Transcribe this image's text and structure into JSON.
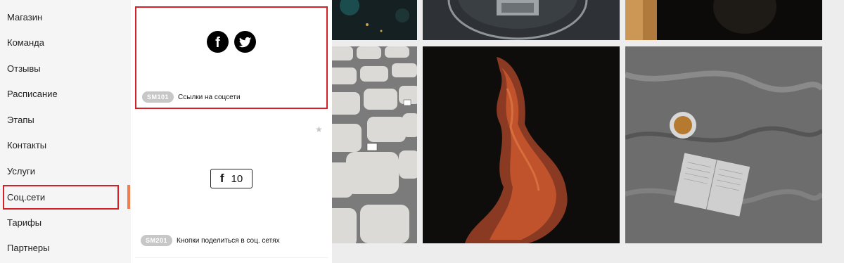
{
  "sidebar": {
    "items": [
      {
        "label": "Магазин"
      },
      {
        "label": "Команда"
      },
      {
        "label": "Отзывы"
      },
      {
        "label": "Расписание"
      },
      {
        "label": "Этапы"
      },
      {
        "label": "Контакты"
      },
      {
        "label": "Услуги"
      },
      {
        "label": "Соц.сети"
      },
      {
        "label": "Тарифы"
      },
      {
        "label": "Партнеры"
      }
    ],
    "active_label": "Соц.сети"
  },
  "blocks": [
    {
      "code": "SM101",
      "title": "Ссылки на соцсети",
      "icons": [
        "facebook-icon",
        "twitter-icon"
      ]
    },
    {
      "code": "SM201",
      "title": "Кнопки поделиться в соц. сетях",
      "share_icon_text": "f",
      "share_count": "10"
    }
  ],
  "colors": {
    "highlight_border": "#d42027",
    "active_bar": "#f07c4f",
    "badge_bg": "#c7c7c7"
  }
}
